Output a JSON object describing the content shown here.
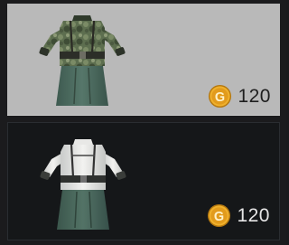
{
  "items": [
    {
      "name": "camouflage-outfit",
      "currency_symbol": "G",
      "price": "120",
      "selected": true
    },
    {
      "name": "white-outfit",
      "currency_symbol": "G",
      "price": "120",
      "selected": false
    }
  ],
  "icons": {
    "currency": "gold-coin-icon",
    "item1": "camouflage-uniform-icon",
    "item2": "white-uniform-icon"
  },
  "colors": {
    "selected_card_bg": "#b9b9b9",
    "unselected_card_bg": "#151719",
    "coin_gold": "#e7a624",
    "skirt_green": "#4c6a5e"
  }
}
